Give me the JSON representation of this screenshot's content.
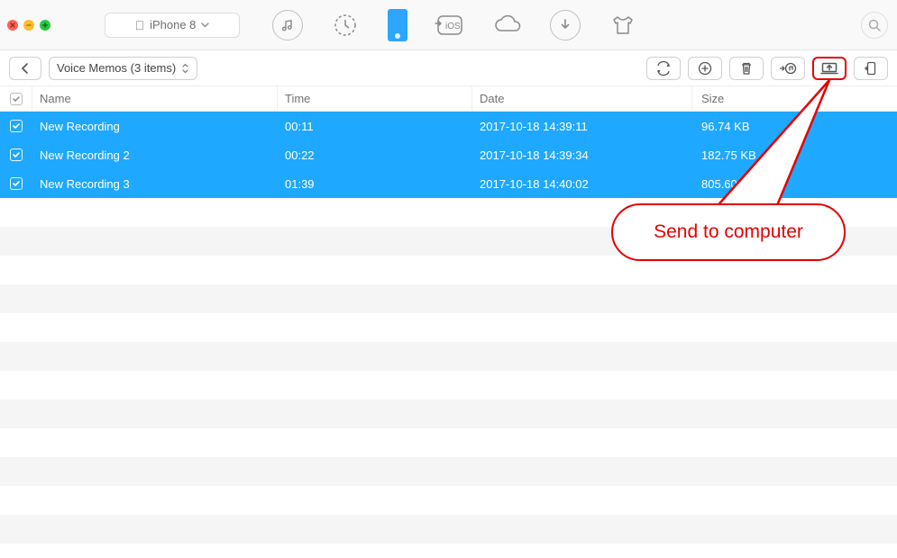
{
  "traffic_colors": {
    "close": "#ff5f57",
    "min": "#febc2e",
    "max": "#28c840"
  },
  "device": {
    "name": "iPhone 8"
  },
  "breadcrumb": {
    "label": "Voice Memos (3 items)"
  },
  "columns": {
    "name": "Name",
    "time": "Time",
    "date": "Date",
    "size": "Size"
  },
  "rows": [
    {
      "checked": true,
      "name": "New Recording",
      "time": "00:11",
      "date": "2017-10-18 14:39:11",
      "size": "96.74 KB"
    },
    {
      "checked": true,
      "name": "New Recording 2",
      "time": "00:22",
      "date": "2017-10-18 14:39:34",
      "size": "182.75 KB"
    },
    {
      "checked": true,
      "name": "New Recording 3",
      "time": "01:39",
      "date": "2017-10-18 14:40:02",
      "size": "805.60 KB"
    }
  ],
  "annotation": {
    "label": "Send to computer"
  }
}
